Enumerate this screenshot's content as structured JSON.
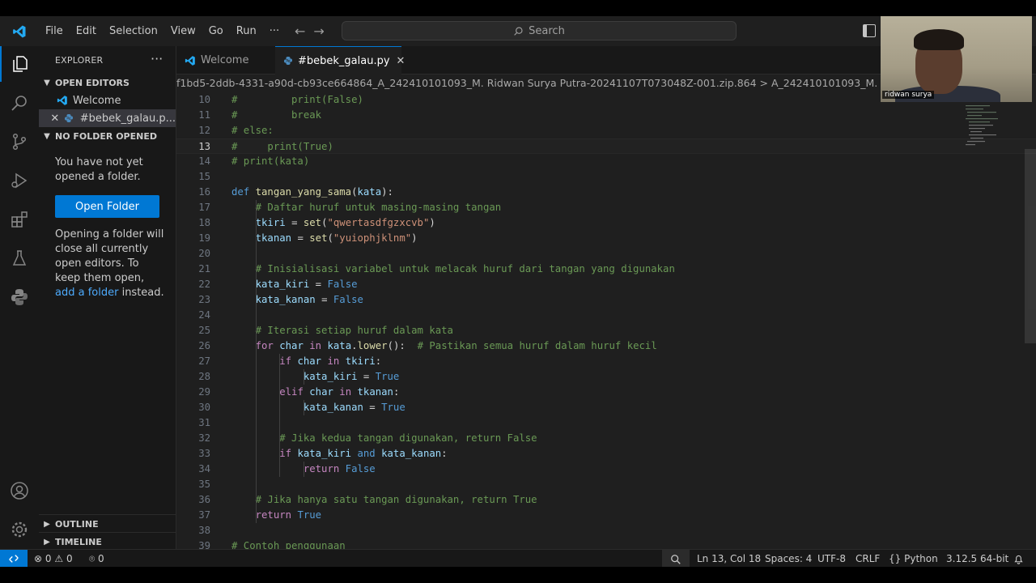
{
  "menu": [
    "File",
    "Edit",
    "Selection",
    "View",
    "Go",
    "Run",
    "···"
  ],
  "search_label": "Search",
  "explorer": {
    "title": "EXPLORER",
    "more": "···",
    "open_editors": "OPEN EDITORS",
    "open_files": [
      {
        "name": "Welcome"
      },
      {
        "name": "#bebek_galau.p..."
      }
    ],
    "no_folder": "NO FOLDER OPENED",
    "no_folder_msg": "You have not yet opened a folder.",
    "open_folder_button": "Open Folder",
    "hint_pre": "Opening a folder will close all currently open editors. To keep them open, ",
    "hint_link": "add a folder",
    "hint_post": " instead.",
    "outline": "OUTLINE",
    "timeline": "TIMELINE"
  },
  "tabs": [
    {
      "label": "Welcome",
      "active": false
    },
    {
      "label": "#bebek_galau.py",
      "active": true
    }
  ],
  "breadcrumb": "f1bd5-2ddb-4331-a90d-cb93ce664864_A_242410101093_M. Ridwan Surya Putra-20241107T073048Z-001.zip.864 > A_242410101093_M. Ridwan Surya P",
  "code_lines": [
    {
      "n": "10",
      "t": "#         print(False)"
    },
    {
      "n": "11",
      "t": "#         break"
    },
    {
      "n": "12",
      "t": "# else:"
    },
    {
      "n": "13",
      "t": "#     print(True)"
    },
    {
      "n": "14",
      "t": "# print(kata)"
    },
    {
      "n": "15",
      "t": ""
    },
    {
      "n": "16",
      "t": "def tangan_yang_sama(kata):"
    },
    {
      "n": "17",
      "t": "    # Daftar huruf untuk masing-masing tangan"
    },
    {
      "n": "18",
      "t": "    tkiri = set(\"qwertasdfgzxcvb\")"
    },
    {
      "n": "19",
      "t": "    tkanan = set(\"yuiophjklnm\")"
    },
    {
      "n": "20",
      "t": ""
    },
    {
      "n": "21",
      "t": "    # Inisialisasi variabel untuk melacak huruf dari tangan yang digunakan"
    },
    {
      "n": "22",
      "t": "    kata_kiri = False"
    },
    {
      "n": "23",
      "t": "    kata_kanan = False"
    },
    {
      "n": "24",
      "t": ""
    },
    {
      "n": "25",
      "t": "    # Iterasi setiap huruf dalam kata"
    },
    {
      "n": "26",
      "t": "    for char in kata.lower():  # Pastikan semua huruf dalam huruf kecil"
    },
    {
      "n": "27",
      "t": "        if char in tkiri:"
    },
    {
      "n": "28",
      "t": "            kata_kiri = True"
    },
    {
      "n": "29",
      "t": "        elif char in tkanan:"
    },
    {
      "n": "30",
      "t": "            kata_kanan = True"
    },
    {
      "n": "31",
      "t": ""
    },
    {
      "n": "32",
      "t": "        # Jika kedua tangan digunakan, return False"
    },
    {
      "n": "33",
      "t": "        if kata_kiri and kata_kanan:"
    },
    {
      "n": "34",
      "t": "            return False"
    },
    {
      "n": "35",
      "t": ""
    },
    {
      "n": "36",
      "t": "    # Jika hanya satu tangan digunakan, return True"
    },
    {
      "n": "37",
      "t": "    return True"
    },
    {
      "n": "38",
      "t": ""
    },
    {
      "n": "39",
      "t": "# Contoh penggunaan"
    }
  ],
  "status": {
    "errors": "0",
    "warnings": "0",
    "ports": "0",
    "position": "Ln 13, Col 18",
    "spaces": "Spaces: 4",
    "encoding": "UTF-8",
    "eol": "CRLF",
    "language": "Python",
    "interpreter": "3.12.5 64-bit"
  },
  "webcam_name": "ridwan surya",
  "colors": {
    "accent": "#0078d4",
    "editor_bg": "#1f1f1f",
    "sidebar_bg": "#181818"
  }
}
